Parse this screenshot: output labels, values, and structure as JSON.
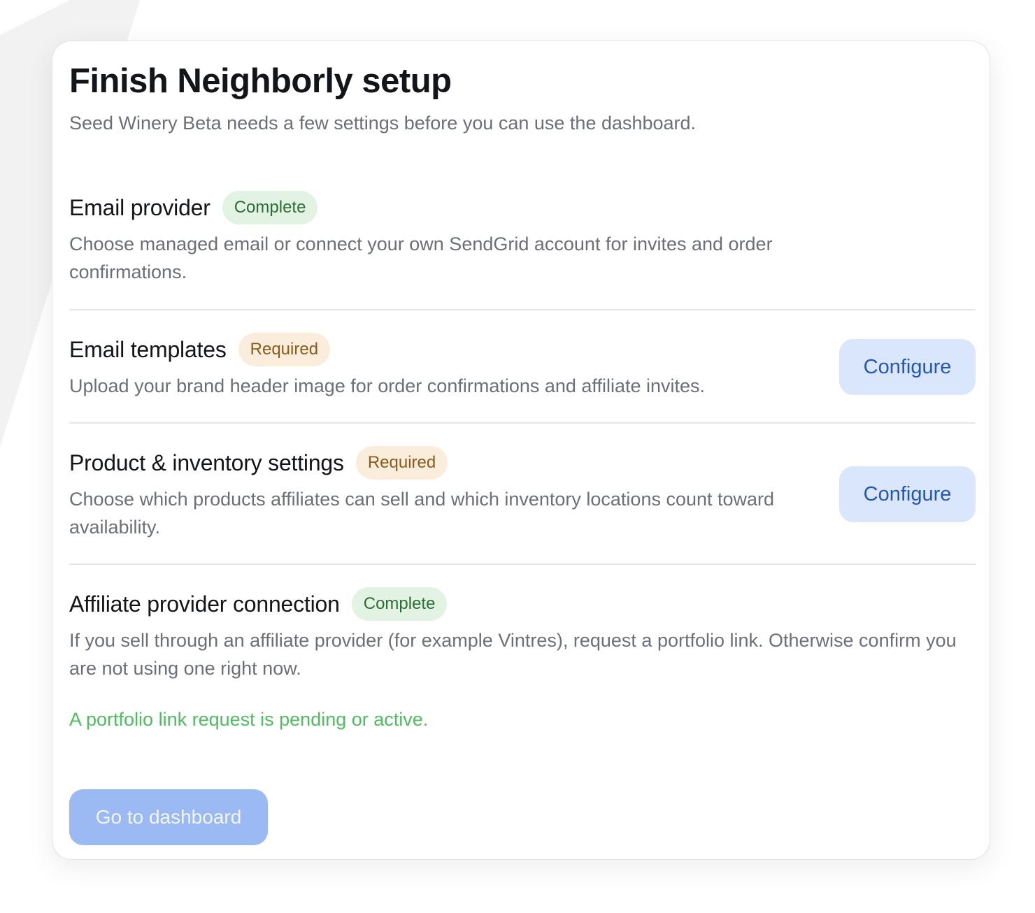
{
  "header": {
    "title": "Finish Neighborly setup",
    "subtitle": "Seed Winery Beta needs a few settings before you can use the dashboard."
  },
  "sections": [
    {
      "title": "Email provider",
      "status": "Complete",
      "description": "Choose managed email or connect your own SendGrid account for invites and order confirmations.",
      "action": null
    },
    {
      "title": "Email templates",
      "status": "Required",
      "description": "Upload your brand header image for order confirmations and affiliate invites.",
      "action": "Configure"
    },
    {
      "title": "Product & inventory settings",
      "status": "Required",
      "description": "Choose which products affiliates can sell and which inventory locations count toward availability.",
      "action": "Configure"
    },
    {
      "title": "Affiliate provider connection",
      "status": "Complete",
      "description": "If you sell through an affiliate provider (for example Vintres), request a portfolio link. Otherwise confirm you are not using one right now.",
      "action": null
    }
  ],
  "pending_note": "A portfolio link request is pending or active.",
  "footer": {
    "dashboard_label": "Go to dashboard",
    "dashboard_enabled": false
  },
  "colors": {
    "complete_badge_bg": "#e2f3e4",
    "complete_badge_text": "#2c6e35",
    "required_badge_bg": "#fbeddb",
    "required_badge_text": "#8a5a1a",
    "configure_bg": "#d9e6fb",
    "configure_text": "#2456b8",
    "pending_text": "#4dbd5e",
    "disabled_button_bg": "#9bb9f2"
  }
}
